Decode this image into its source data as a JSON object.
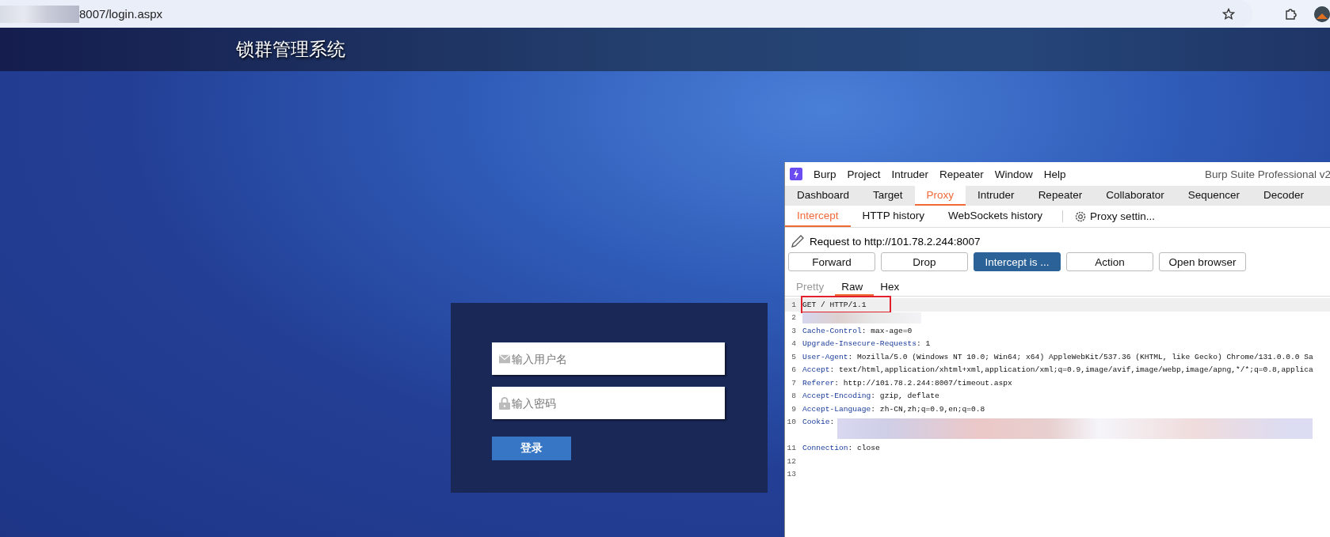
{
  "browser": {
    "url": "8007/login.aspx"
  },
  "site": {
    "title": "锁群管理系统"
  },
  "login": {
    "username": {
      "placeholder": "输入用户名"
    },
    "password": {
      "placeholder": "输入密码"
    },
    "submit": "登录"
  },
  "burp": {
    "menu": [
      "Burp",
      "Project",
      "Intruder",
      "Repeater",
      "Window",
      "Help"
    ],
    "title": "Burp Suite Professional v2",
    "tabs": [
      {
        "label": "Dashboard",
        "selected": false
      },
      {
        "label": "Target",
        "selected": false
      },
      {
        "label": "Proxy",
        "selected": true
      },
      {
        "label": "Intruder",
        "selected": false
      },
      {
        "label": "Repeater",
        "selected": false
      },
      {
        "label": "Collaborator",
        "selected": false
      },
      {
        "label": "Sequencer",
        "selected": false
      },
      {
        "label": "Decoder",
        "selected": false
      }
    ],
    "subtabs": [
      {
        "label": "Intercept",
        "selected": true
      },
      {
        "label": "HTTP history",
        "selected": false
      },
      {
        "label": "WebSockets history",
        "selected": false
      }
    ],
    "settings": "Proxy settin...",
    "request_label": "Request to http://101.78.2.244:8007",
    "buttons": [
      {
        "label": "Forward",
        "selected": false
      },
      {
        "label": "Drop",
        "selected": false
      },
      {
        "label": "Intercept is ...",
        "selected": true
      },
      {
        "label": "Action",
        "selected": false
      },
      {
        "label": "Open browser",
        "selected": false
      }
    ],
    "view_tabs": [
      {
        "label": "Pretty",
        "selected": false,
        "disabled": true
      },
      {
        "label": "Raw",
        "selected": true,
        "disabled": false
      },
      {
        "label": "Hex",
        "selected": false,
        "disabled": false
      }
    ],
    "lines": [
      {
        "number": "1",
        "kind": "request",
        "text": "GET / HTTP/1.1",
        "highlighted": true
      },
      {
        "number": "2",
        "kind": "redacted",
        "highlighted": false
      },
      {
        "number": "3",
        "kind": "header",
        "name": "Cache-Control",
        "value": ": max-age=0",
        "highlighted": false
      },
      {
        "number": "4",
        "kind": "header",
        "name": "Upgrade-Insecure-Requests",
        "value": ": 1",
        "highlighted": false
      },
      {
        "number": "5",
        "kind": "header",
        "name": "User-Agent",
        "value": ": Mozilla/5.0 (Windows NT 10.0; Win64; x64) AppleWebKit/537.36 (KHTML, like Gecko) Chrome/131.0.0.0 Sa",
        "highlighted": false
      },
      {
        "number": "6",
        "kind": "header",
        "name": "Accept",
        "value": ": text/html,application/xhtml+xml,application/xml;q=0.9,image/avif,image/webp,image/apng,*/*;q=0.8,applica",
        "highlighted": false
      },
      {
        "number": "7",
        "kind": "header",
        "name": "Referer",
        "value": ": http://101.78.2.244:8007/timeout.aspx",
        "highlighted": false
      },
      {
        "number": "8",
        "kind": "header",
        "name": "Accept-Encoding",
        "value": ": gzip, deflate",
        "highlighted": false
      },
      {
        "number": "9",
        "kind": "header",
        "name": "Accept-Language",
        "value": ": zh-CN,zh;q=0.9,en;q=0.8",
        "highlighted": false
      },
      {
        "number": "10",
        "kind": "header-redacted",
        "name": "Cookie",
        "value": ":",
        "highlighted": false
      },
      {
        "number": "11",
        "kind": "header",
        "name": "Connection",
        "value": ": close",
        "highlighted": false
      },
      {
        "number": "12",
        "kind": "empty",
        "highlighted": false
      },
      {
        "number": "13",
        "kind": "empty",
        "highlighted": false
      }
    ]
  }
}
